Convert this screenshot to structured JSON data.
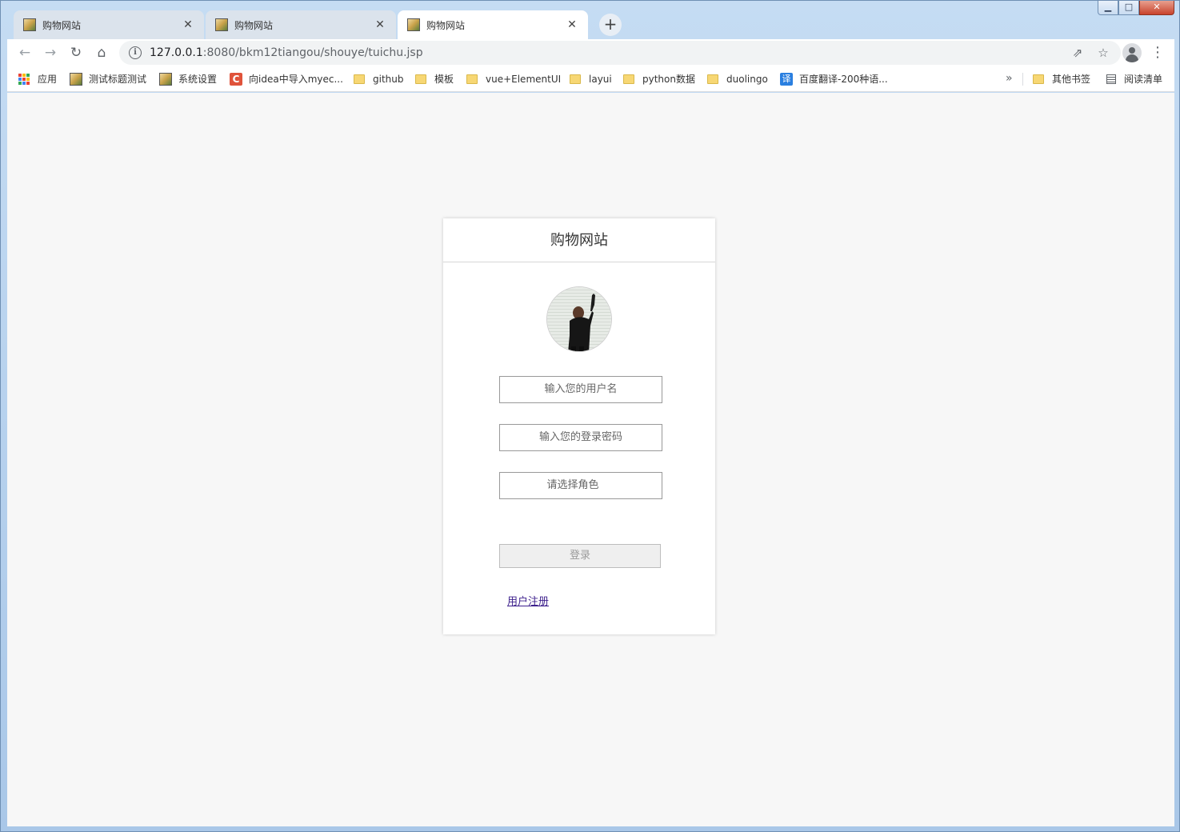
{
  "window": {
    "caption_min": "▁",
    "caption_max": "□",
    "caption_close": "✕"
  },
  "tabs": [
    {
      "title": "购物网站",
      "active": false
    },
    {
      "title": "购物网站",
      "active": false
    },
    {
      "title": "购物网站",
      "active": true
    }
  ],
  "tab_close_glyph": "✕",
  "new_tab_glyph": "+",
  "toolbar": {
    "back_glyph": "←",
    "forward_glyph": "→",
    "reload_glyph": "↻",
    "home_glyph": "⌂",
    "url_host": "127.0.0.1",
    "url_rest": ":8080/bkm12tiangou/shouye/tuichu.jsp",
    "share_glyph": "⇗",
    "star_glyph": "☆",
    "menu_glyph": "⋮"
  },
  "bookmarks": {
    "apps": "应用",
    "items": [
      {
        "label": "测试标题测试",
        "icon": "site-favicon"
      },
      {
        "label": "系统设置",
        "icon": "site-favicon"
      },
      {
        "label": "向idea中导入myec...",
        "icon": "c-favicon"
      },
      {
        "label": "github",
        "icon": "folder-icon"
      },
      {
        "label": "模板",
        "icon": "folder-icon"
      },
      {
        "label": "vue+ElementUI",
        "icon": "folder-icon"
      },
      {
        "label": "layui",
        "icon": "folder-icon"
      },
      {
        "label": "python数据",
        "icon": "folder-icon"
      },
      {
        "label": "duolingo",
        "icon": "folder-icon"
      },
      {
        "label": "百度翻译-200种语...",
        "icon": "translate-favicon"
      }
    ],
    "c_glyph": "C",
    "translate_glyph": "译",
    "overflow_glyph": "»",
    "other": "其他书签",
    "reading_list": "阅读清单"
  },
  "login": {
    "title": "购物网站",
    "username_placeholder": "输入您的用户名",
    "password_placeholder": "输入您的登录密码",
    "role_placeholder": "请选择角色",
    "login_button": "登录",
    "register_link": "用户注册"
  },
  "colors": {
    "page_bg": "#f7f7f7",
    "card_bg": "#ffffff",
    "link": "#3c1f8c",
    "button_bg": "#efefef"
  }
}
